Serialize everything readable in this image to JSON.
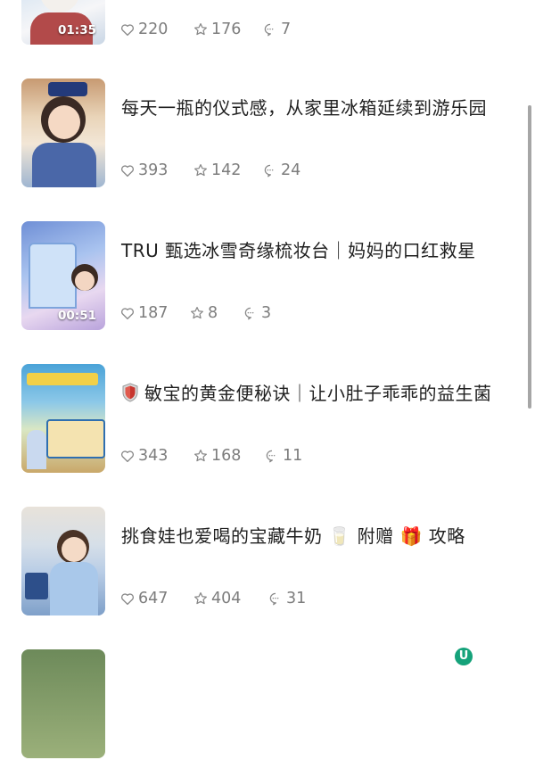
{
  "feed": {
    "items": [
      {
        "title": "",
        "duration": "01:35",
        "likes": "220",
        "favorites": "176",
        "comments": "7"
      },
      {
        "title": "每天一瓶的仪式感，从家里冰箱延续到游乐园",
        "duration": "",
        "likes": "393",
        "favorites": "142",
        "comments": "24"
      },
      {
        "title": "TRU 甄选冰雪奇缘梳妆台｜妈妈的口红救星",
        "duration": "00:51",
        "likes": "187",
        "favorites": "8",
        "comments": "3"
      },
      {
        "title": "敏宝的黄金便秘诀｜让小肚子乖乖的益生菌",
        "duration": "",
        "likes": "343",
        "favorites": "168",
        "comments": "11"
      },
      {
        "title": "挑食娃也爱喝的宝藏牛奶 🥛 附赠 🎁 攻略",
        "duration": "",
        "likes": "647",
        "favorites": "404",
        "comments": "31"
      }
    ]
  },
  "floating_button": {
    "label": "U"
  },
  "icons": {
    "like": "heart-icon",
    "favorite": "star-icon",
    "comment": "comment-bubble-icon",
    "shield": "shield-icon"
  }
}
